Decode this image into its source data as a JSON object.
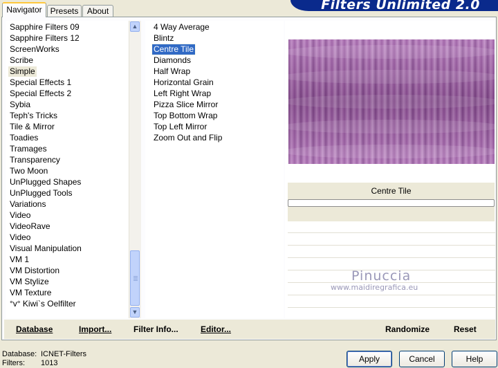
{
  "tabs": [
    {
      "label": "Navigator"
    },
    {
      "label": "Presets"
    },
    {
      "label": "About"
    }
  ],
  "banner_title": "Filters Unlimited 2.0",
  "categories": [
    "Sapphire Filters 09",
    "Sapphire Filters 12",
    "ScreenWorks",
    "Scribe",
    "Simple",
    "Special Effects 1",
    "Special Effects 2",
    "Sybia",
    "Teph's Tricks",
    "Tile & Mirror",
    "Toadies",
    "Tramages",
    "Transparency",
    "Two Moon",
    "UnPlugged Shapes",
    "UnPlugged Tools",
    "Variations",
    "Video",
    "VideoRave",
    "Video",
    "Visual Manipulation",
    "VM 1",
    "VM Distortion",
    "VM Stylize",
    "VM Texture",
    "°v° Kiwi`s Oelfilter"
  ],
  "highlighted_category": "Simple",
  "filters": [
    "4 Way Average",
    "Blintz",
    "Centre Tile",
    "Diamonds",
    "Half Wrap",
    "Horizontal Grain",
    "Left Right Wrap",
    "Pizza Slice Mirror",
    "Top Bottom Wrap",
    "Top Left Mirror",
    "Zoom Out and Flip"
  ],
  "selected_filter": "Centre Tile",
  "preview": {
    "filter_name": "Centre Tile",
    "tint_color": "#a35ca8",
    "watermark_name": "Pinuccia",
    "watermark_url": "www.maidiregrafica.eu"
  },
  "actions": {
    "database": "Database",
    "import": "Import...",
    "filter_info": "Filter Info...",
    "editor": "Editor...",
    "randomize": "Randomize",
    "reset": "Reset"
  },
  "status": {
    "database_label": "Database:",
    "database_value": "ICNET-Filters",
    "filters_label": "Filters:",
    "filters_value": "1013"
  },
  "buttons": {
    "apply": "Apply",
    "cancel": "Cancel",
    "help": "Help"
  },
  "colors": {
    "selection": "#316ac5",
    "banner": "#0a2a8c",
    "dialog_bg": "#ece9d8"
  }
}
